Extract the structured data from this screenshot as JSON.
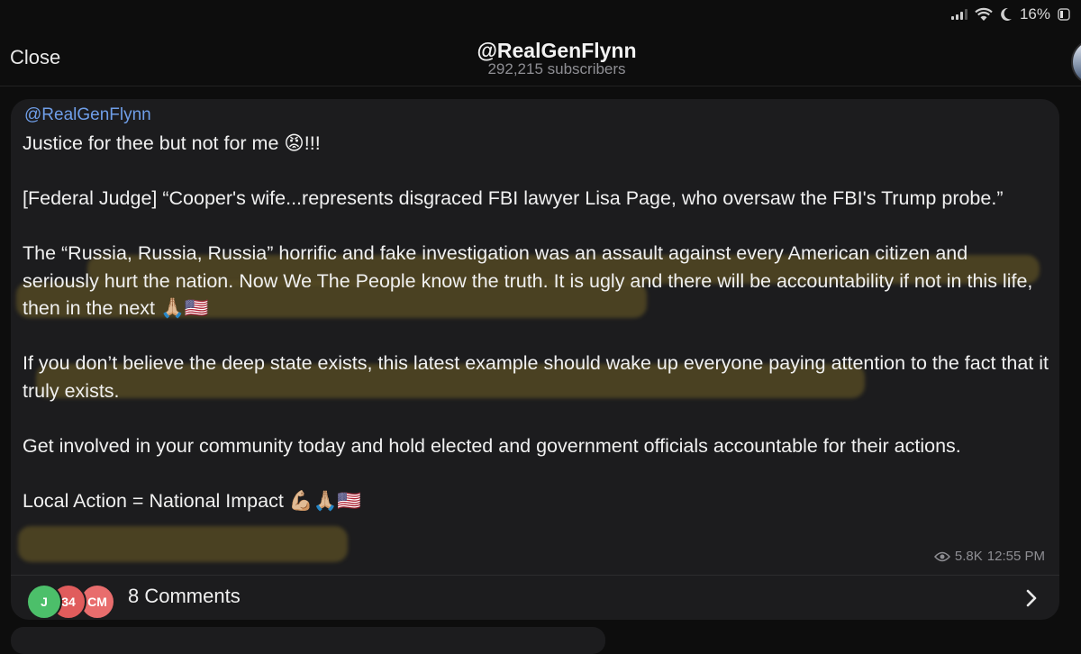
{
  "status_bar": {
    "battery": "16%",
    "icons": [
      "signal-icon",
      "wifi-icon",
      "moon-icon"
    ]
  },
  "header": {
    "close_label": "Close",
    "channel_title": "@RealGenFlynn",
    "subscribers": "292,215 subscribers"
  },
  "post": {
    "author": "@RealGenFlynn",
    "paragraphs": [
      "Justice for thee but not for me 😡!!!",
      "[Federal Judge] “Cooper's wife...represents disgraced FBI lawyer Lisa Page, who oversaw the FBI's Trump probe.”",
      "The “Russia, Russia, Russia” horrific and fake investigation was an assault against every American citizen and seriously hurt the nation. Now We The People know the truth. It is ugly and there will be accountability if not in this life, then in the next 🙏🏼🇺🇸",
      "If you don’t believe the deep state exists, this latest example should wake up everyone paying attention to the fact that it truly exists.",
      "Get involved in your community today and hold elected and government officials accountable for their actions.",
      "Local Action = National Impact 💪🏼🙏🏼🇺🇸"
    ],
    "views": "5.8K",
    "time": "12:55 PM"
  },
  "comments": {
    "label": "8 Comments",
    "avatars": [
      "J",
      "34",
      "CM"
    ]
  },
  "colors": {
    "accent": "#6f9ee8",
    "bubble": "#1c1c1e",
    "highlight": "#826e28"
  }
}
